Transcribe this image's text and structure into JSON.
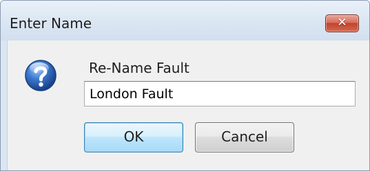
{
  "window": {
    "title": "Enter Name",
    "close_glyph": "✕",
    "close_icon": "close-icon"
  },
  "prompt": {
    "icon": "question-icon",
    "label": "Re-Name Fault"
  },
  "name_field": {
    "value": "London Fault"
  },
  "buttons": {
    "ok": "OK",
    "cancel": "Cancel"
  },
  "colors": {
    "title_bar": "#dbe6f3",
    "content_bg": "#f0f0f0",
    "close_button": "#c1432e",
    "icon_blue": "#2a5fb4",
    "default_button_border": "#3c7fb1"
  }
}
